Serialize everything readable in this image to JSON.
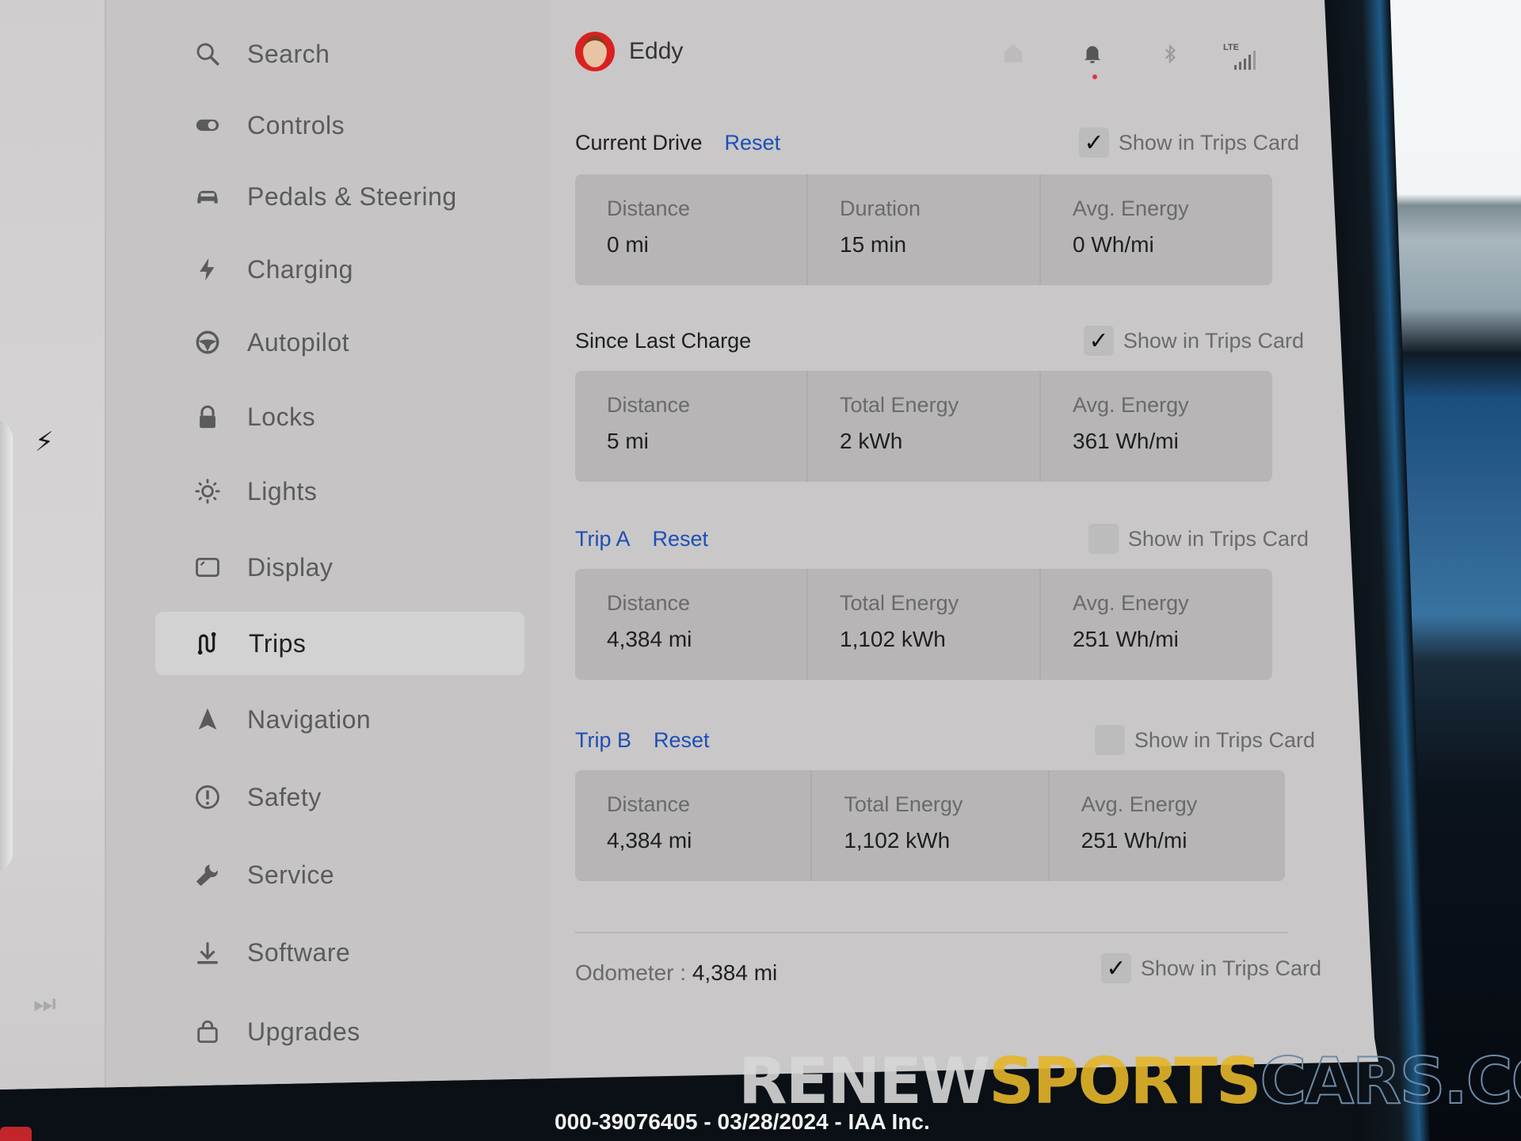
{
  "profile": {
    "name": "Eddy"
  },
  "status_bar": {
    "icons": [
      "home-icon",
      "bell-icon",
      "bluetooth-icon",
      "lte-signal-icon"
    ],
    "network_label": "LTE",
    "notification_dot_color": "#e1323a"
  },
  "sidebar": {
    "items": [
      {
        "label": "Search",
        "icon": "search-icon"
      },
      {
        "label": "Controls",
        "icon": "toggle-icon"
      },
      {
        "label": "Pedals & Steering",
        "icon": "car-icon"
      },
      {
        "label": "Charging",
        "icon": "charging-bolt-icon"
      },
      {
        "label": "Autopilot",
        "icon": "steering-wheel-icon"
      },
      {
        "label": "Locks",
        "icon": "lock-icon"
      },
      {
        "label": "Lights",
        "icon": "light-bulb-icon"
      },
      {
        "label": "Display",
        "icon": "display-icon"
      },
      {
        "label": "Trips",
        "icon": "trips-route-icon",
        "active": true
      },
      {
        "label": "Navigation",
        "icon": "navigation-arrow-icon"
      },
      {
        "label": "Safety",
        "icon": "safety-alert-icon"
      },
      {
        "label": "Service",
        "icon": "wrench-icon"
      },
      {
        "label": "Software",
        "icon": "download-icon"
      },
      {
        "label": "Upgrades",
        "icon": "shopping-bag-icon"
      }
    ]
  },
  "trips": {
    "current_drive": {
      "title": "Current Drive",
      "reset_label": "Reset",
      "show_label": "Show in Trips Card",
      "show_checked": true,
      "cells": [
        {
          "label": "Distance",
          "value": "0 mi"
        },
        {
          "label": "Duration",
          "value": "15 min"
        },
        {
          "label": "Avg. Energy",
          "value": "0 Wh/mi"
        }
      ]
    },
    "since_last_charge": {
      "title": "Since Last Charge",
      "show_label": "Show in Trips Card",
      "show_checked": true,
      "cells": [
        {
          "label": "Distance",
          "value": "5 mi"
        },
        {
          "label": "Total Energy",
          "value": "2 kWh"
        },
        {
          "label": "Avg. Energy",
          "value": "361 Wh/mi"
        }
      ]
    },
    "trip_a": {
      "title": "Trip A",
      "reset_label": "Reset",
      "show_label": "Show in Trips Card",
      "show_checked": false,
      "cells": [
        {
          "label": "Distance",
          "value": "4,384 mi"
        },
        {
          "label": "Total Energy",
          "value": "1,102 kWh"
        },
        {
          "label": "Avg. Energy",
          "value": "251 Wh/mi"
        }
      ]
    },
    "trip_b": {
      "title": "Trip B",
      "reset_label": "Reset",
      "show_label": "Show in Trips Card",
      "show_checked": false,
      "cells": [
        {
          "label": "Distance",
          "value": "4,384 mi"
        },
        {
          "label": "Total Energy",
          "value": "1,102 kWh"
        },
        {
          "label": "Avg. Energy",
          "value": "251 Wh/mi"
        }
      ]
    },
    "odometer": {
      "label": "Odometer :",
      "value": "4,384 mi",
      "show_label": "Show in Trips Card",
      "show_checked": true
    }
  },
  "colors": {
    "accent_link": "#1c4fb5",
    "screen_bg": "#c9c7c8",
    "card_bg": "#b7b5b6"
  },
  "overlay": {
    "watermark_part1": "RENEW",
    "watermark_part2": "SPORTS",
    "watermark_part3": "CARS.COM",
    "caption": "000-39076405 - 03/28/2024 - IAA Inc."
  }
}
